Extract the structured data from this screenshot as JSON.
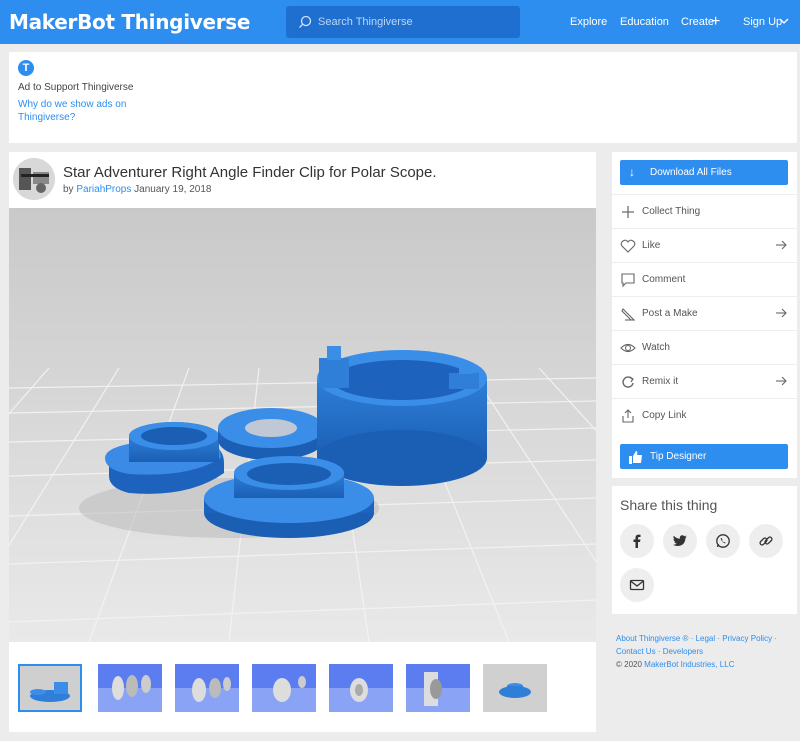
{
  "header": {
    "brand": "MakerBot Thingiverse",
    "search_placeholder": "Search Thingiverse",
    "nav": {
      "explore": "Explore",
      "education": "Education",
      "create": "Create",
      "signup": "Sign Up"
    }
  },
  "ad": {
    "support": "Ad to Support Thingiverse",
    "why": "Why do we show ads on Thingiverse?"
  },
  "thing": {
    "title": "Star Adventurer Right Angle Finder Clip for Polar Scope.",
    "by": "by",
    "author": "PariahProps",
    "date": "January 19, 2018"
  },
  "actions": {
    "download": "Download All Files",
    "items": [
      {
        "label": "Collect Thing",
        "icon": "plus-icon",
        "arrow": false
      },
      {
        "label": "Like",
        "icon": "heart-icon",
        "arrow": true
      },
      {
        "label": "Comment",
        "icon": "comment-icon",
        "arrow": false
      },
      {
        "label": "Post a Make",
        "icon": "pencil-icon",
        "arrow": true
      },
      {
        "label": "Watch",
        "icon": "eye-icon",
        "arrow": false
      },
      {
        "label": "Remix it",
        "icon": "remix-icon",
        "arrow": true
      },
      {
        "label": "Copy Link",
        "icon": "share-icon",
        "arrow": false
      }
    ],
    "tip": "Tip Designer"
  },
  "share": {
    "title": "Share this thing"
  },
  "footer": {
    "about": "About Thingiverse ®",
    "legal": "Legal",
    "privacy": "Privacy Policy",
    "contact": "Contact Us",
    "developers": "Developers",
    "copyright": "© 2020",
    "company": "MakerBot Industries, LLC"
  },
  "colors": {
    "brand_blue": "#2d8ef0",
    "search_bg": "#1f6fd1",
    "page_bg": "#ececec"
  }
}
